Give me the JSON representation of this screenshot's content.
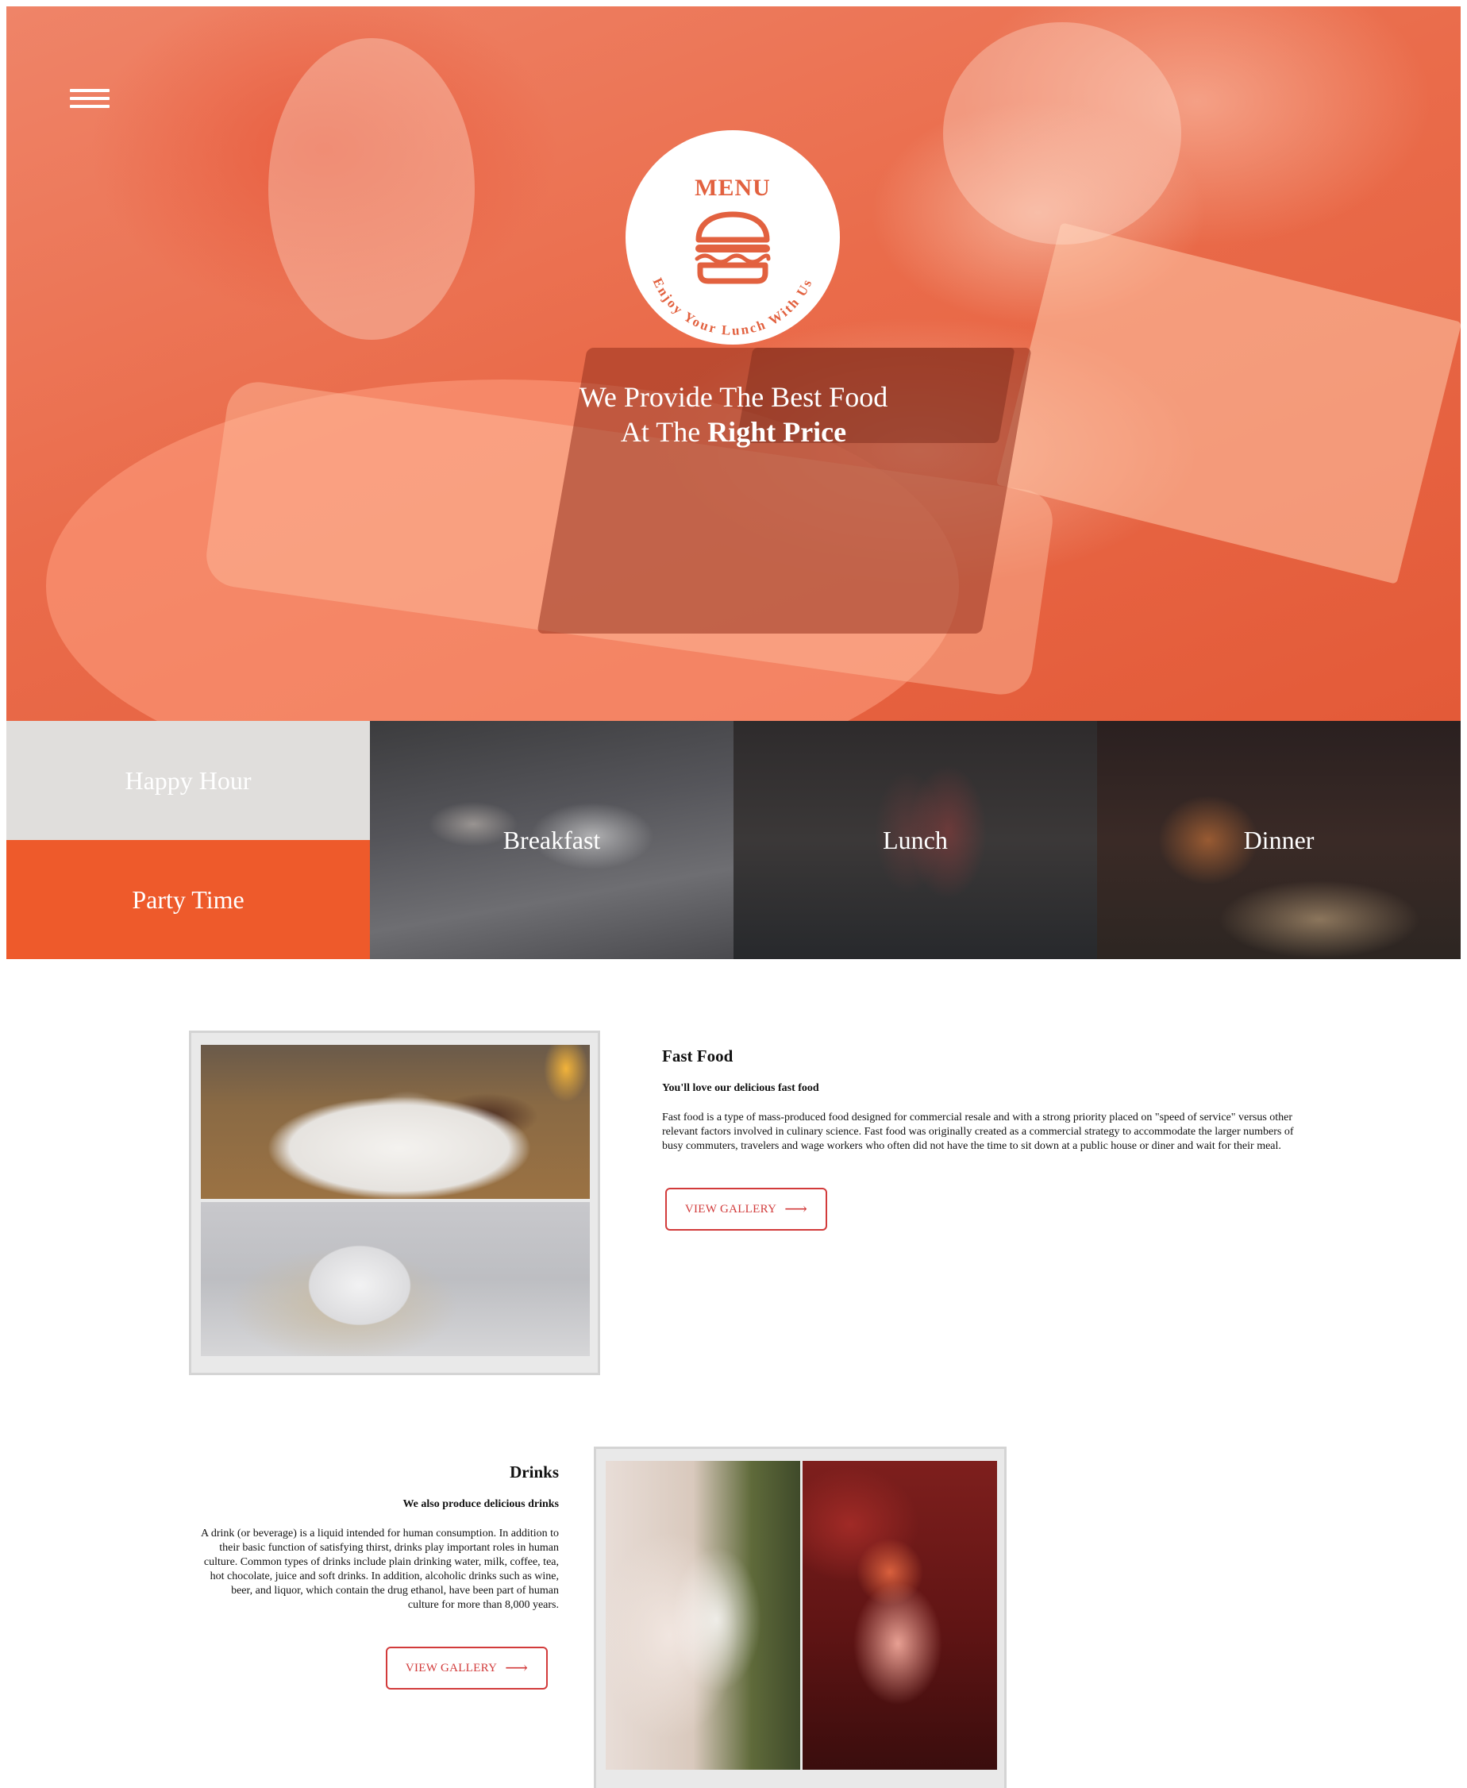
{
  "hero": {
    "logo_title": "MENU",
    "logo_tagline": "Enjoy Your Lunch With Us",
    "tagline_line1": "We Provide The Best Food",
    "tagline_line2_prefix": "At The",
    "tagline_line2_strong": "Right Price"
  },
  "tiles": {
    "happy_hour": "Happy Hour",
    "party_time": "Party Time",
    "breakfast": "Breakfast",
    "lunch": "Lunch",
    "dinner": "Dinner"
  },
  "fast_food": {
    "title": "Fast Food",
    "subtitle": "You'll love our delicious fast food",
    "body": "Fast food is a type of mass-produced food designed for commercial resale and with a strong priority placed on \"speed of service\" versus other relevant factors involved in culinary science. Fast food was originally created as a commercial strategy to accommodate the larger numbers of busy commuters, travelers and wage workers who often did not have the time to sit down at a public house or diner and wait for their meal.",
    "button": "VIEW GALLERY"
  },
  "drinks": {
    "title": "Drinks",
    "subtitle": "We also produce delicious drinks",
    "body": "A drink (or beverage) is a liquid intended for human consumption. In addition to their basic function of satisfying thirst, drinks play important roles in human culture. Common types of drinks include plain drinking water, milk, coffee, tea, hot chocolate, juice and soft drinks. In addition, alcoholic drinks such as wine, beer, and liquor, which contain the drug ethanol, have been part of human culture for more than 8,000 years.",
    "button": "VIEW GALLERY"
  },
  "icons": {
    "menu": "hamburger-menu-icon",
    "logo": "burger-icon",
    "arrow": "arrow-right-icon"
  },
  "colors": {
    "accent": "#ee5a2b",
    "logo_text": "#e2613f",
    "button": "#d23b3b",
    "happy_hour_bg": "#e0dedc"
  }
}
